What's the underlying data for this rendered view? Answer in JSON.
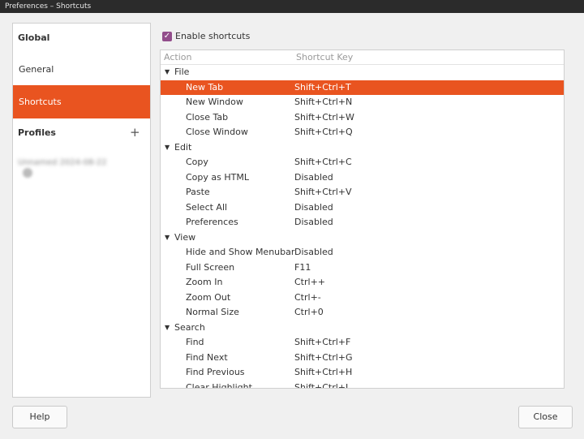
{
  "window": {
    "title": "Preferences – Shortcuts"
  },
  "sidebar": {
    "global_label": "Global",
    "general_label": "General",
    "shortcuts_label": "Shortcuts",
    "profiles_label": "Profiles",
    "add_label": "+",
    "profile_item": "Unnamed 2024-08-22"
  },
  "main": {
    "enable_label": "Enable shortcuts",
    "enable_checked": true,
    "columns": {
      "action": "Action",
      "key": "Shortcut Key"
    }
  },
  "groups": [
    {
      "name": "File",
      "items": [
        {
          "action": "New Tab",
          "key": "Shift+Ctrl+T",
          "selected": true
        },
        {
          "action": "New Window",
          "key": "Shift+Ctrl+N"
        },
        {
          "action": "Close Tab",
          "key": "Shift+Ctrl+W"
        },
        {
          "action": "Close Window",
          "key": "Shift+Ctrl+Q"
        }
      ]
    },
    {
      "name": "Edit",
      "items": [
        {
          "action": "Copy",
          "key": "Shift+Ctrl+C"
        },
        {
          "action": "Copy as HTML",
          "key": "Disabled"
        },
        {
          "action": "Paste",
          "key": "Shift+Ctrl+V"
        },
        {
          "action": "Select All",
          "key": "Disabled"
        },
        {
          "action": "Preferences",
          "key": "Disabled"
        }
      ]
    },
    {
      "name": "View",
      "items": [
        {
          "action": "Hide and Show Menubar",
          "key": "Disabled"
        },
        {
          "action": "Full Screen",
          "key": "F11"
        },
        {
          "action": "Zoom In",
          "key": "Ctrl++"
        },
        {
          "action": "Zoom Out",
          "key": "Ctrl+-"
        },
        {
          "action": "Normal Size",
          "key": "Ctrl+0"
        }
      ]
    },
    {
      "name": "Search",
      "items": [
        {
          "action": "Find",
          "key": "Shift+Ctrl+F"
        },
        {
          "action": "Find Next",
          "key": "Shift+Ctrl+G"
        },
        {
          "action": "Find Previous",
          "key": "Shift+Ctrl+H"
        },
        {
          "action": "Clear Highlight",
          "key": "Shift+Ctrl+J"
        }
      ]
    }
  ],
  "buttons": {
    "help": "Help",
    "close": "Close"
  },
  "colors": {
    "accent": "#e95420",
    "checkbox": "#924d8b"
  },
  "icons": {
    "check": "check-icon",
    "caret": "caret-down-icon",
    "add": "plus-icon"
  }
}
